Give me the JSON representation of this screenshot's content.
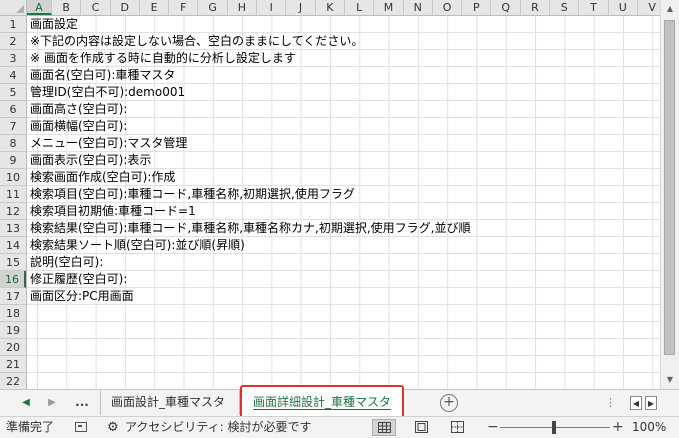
{
  "columns": [
    "A",
    "B",
    "C",
    "D",
    "E",
    "F",
    "G",
    "H",
    "I",
    "J",
    "K",
    "L",
    "M",
    "N",
    "O",
    "P",
    "Q",
    "R",
    "S",
    "T",
    "U",
    "V"
  ],
  "rows": [
    "1",
    "2",
    "3",
    "4",
    "5",
    "6",
    "7",
    "8",
    "9",
    "10",
    "11",
    "12",
    "13",
    "14",
    "15",
    "16",
    "17",
    "18",
    "19",
    "20",
    "21",
    "22"
  ],
  "active_column": "A",
  "active_row": "16",
  "cells": [
    "画面設定",
    "※下記の内容は設定しない場合、空白のままにしてください。",
    "※ 画面を作成する時に自動的に分析し設定します",
    "画面名(空白可):車種マスタ",
    "管理ID(空白不可):demo001",
    "画面高さ(空白可):",
    "画面横幅(空白可):",
    "メニュー(空白可):マスタ管理",
    "画面表示(空白可):表示",
    "検索画面作成(空白可):作成",
    "検索項目(空白可):車種コード,車種名称,初期選択,使用フラグ",
    "検索項目初期値:車種コード=1",
    "検索結果(空白可):車種コード,車種名称,車種名称カナ,初期選択,使用フラグ,並び順",
    "検索結果ソート順(空白可):並び順(昇順)",
    "説明(空白可):",
    "修正履歴(空白可):",
    "画面区分:PC用画面"
  ],
  "sheet_tabs": {
    "more": "...",
    "tab1": "画面設計_車種マスタ",
    "tab2": "画面詳細設計_車種マスタ",
    "add": "+",
    "active": "画面詳細設計_車種マスタ"
  },
  "status": {
    "ready": "準備完了",
    "accessibility": "アクセシビリティ: 検討が必要です",
    "zoom": "100%"
  },
  "icons": {
    "tab_prev": "triangle-left",
    "tab_next": "triangle-right",
    "scroll_up": "triangle-up",
    "scroll_down": "triangle-down",
    "macro": "macro-record-icon",
    "accessibility": "accessibility-icon"
  },
  "colors": {
    "accent": "#217346",
    "highlight_border": "#e0302a"
  }
}
